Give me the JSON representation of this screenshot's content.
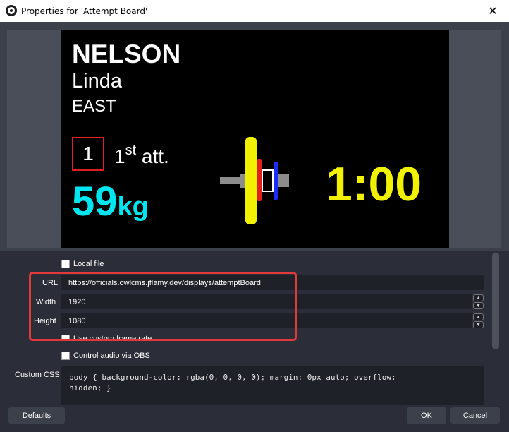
{
  "window": {
    "title": "Properties for 'Attempt Board'",
    "close_glyph": "✕",
    "app_icon": "obs-logo-icon"
  },
  "board": {
    "last_name": "NELSON",
    "first_name": "Linda",
    "team": "EAST",
    "attempt_number": "1",
    "attempt_ordinal": "1",
    "attempt_suffix": "st",
    "attempt_word": "att.",
    "weight_value": "59",
    "weight_unit": "kg",
    "clock": "1:00",
    "colors": {
      "weight": "#00e6f0",
      "clock": "#f2f200",
      "attempt_border": "#e0201c",
      "plate_large": "#f2f200",
      "plate_red": "#e0201c",
      "plate_blue": "#1a2cff"
    }
  },
  "form": {
    "local_file_label": "Local file",
    "url_label": "URL",
    "url_value": "https://officials.owlcms.jflamy.dev/displays/attemptBoard",
    "width_label": "Width",
    "width_value": "1920",
    "height_label": "Height",
    "height_value": "1080",
    "custom_frame_rate_label": "Use custom frame rate",
    "control_audio_label": "Control audio via OBS",
    "custom_css_label": "Custom CSS",
    "custom_css_line1": "body { background-color: rgba(0, 0, 0, 0); margin: 0px auto; overflow:",
    "custom_css_line2": "hidden; }"
  },
  "buttons": {
    "defaults": "Defaults",
    "ok": "OK",
    "cancel": "Cancel"
  }
}
